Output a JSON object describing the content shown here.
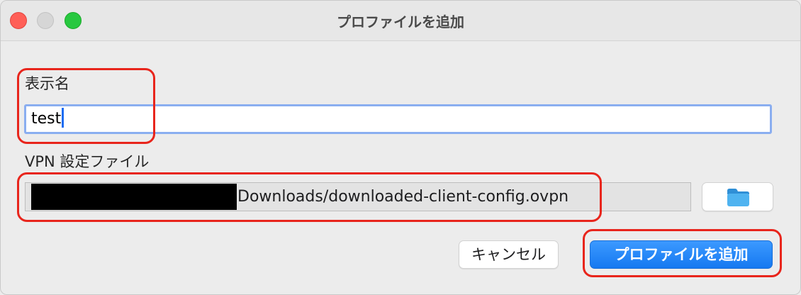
{
  "window": {
    "title": "プロファイルを追加",
    "buttons": [
      "close",
      "minimize",
      "zoom"
    ]
  },
  "form": {
    "display_name_label": "表示名",
    "display_name_value": "test",
    "vpn_file_label": "VPN 設定ファイル",
    "vpn_file_path_visible": "Downloads/downloaded-client-config.ovpn",
    "folder_icon": "folder-icon"
  },
  "actions": {
    "cancel_label": "キャンセル",
    "add_label": "プロファイルを追加"
  },
  "colors": {
    "accent": "#1679f1",
    "highlight": "#e8251c",
    "focus_ring": "#8aaef0",
    "folder": "#4fb3f0"
  }
}
